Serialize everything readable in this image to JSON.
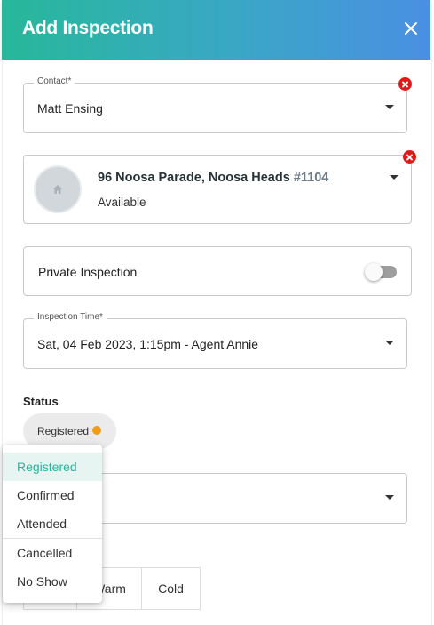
{
  "dialog": {
    "title": "Add Inspection"
  },
  "contact": {
    "label": "Contact*",
    "value": "Matt Ensing"
  },
  "property": {
    "address": "96 Noosa Parade, Noosa Heads",
    "id": "#1104",
    "status": "Available"
  },
  "private_inspection": {
    "label": "Private Inspection",
    "enabled": false
  },
  "inspection_time": {
    "label": "Inspection Time*",
    "value": "Sat, 04 Feb 2023, 1:15pm - Agent Annie"
  },
  "status": {
    "label": "Status",
    "selected": "Registered",
    "dot_color": "#f39c12"
  },
  "status_menu": {
    "items": [
      "Registered",
      "Confirmed",
      "Attended",
      "Cancelled",
      "No Show"
    ],
    "selected_index": 0
  },
  "interest": {
    "options": [
      "",
      "Warm",
      "Cold"
    ]
  },
  "colors": {
    "header_gradient_start": "#27b89a",
    "header_gradient_end": "#4a8fe3",
    "accent": "#2bb39a",
    "error": "#e01919"
  }
}
